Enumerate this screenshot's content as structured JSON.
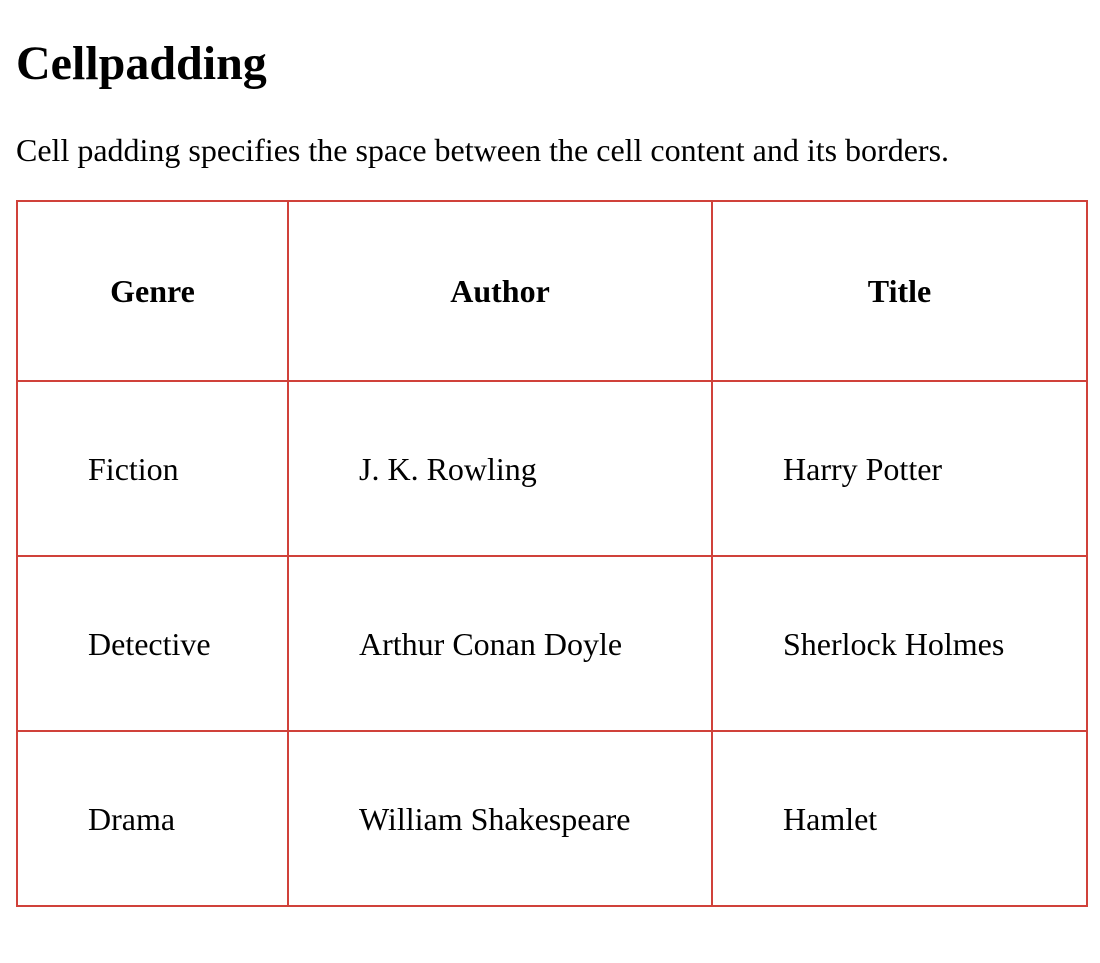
{
  "heading": "Cellpadding",
  "description": "Cell padding specifies the space between the cell content and its borders.",
  "border_color": "#d0413a",
  "table": {
    "headers": [
      "Genre",
      "Author",
      "Title"
    ],
    "rows": [
      [
        "Fiction",
        "J. K. Rowling",
        "Harry Potter"
      ],
      [
        "Detective",
        "Arthur Conan Doyle",
        "Sherlock Holmes"
      ],
      [
        "Drama",
        "William Shakespeare",
        "Hamlet"
      ]
    ]
  }
}
